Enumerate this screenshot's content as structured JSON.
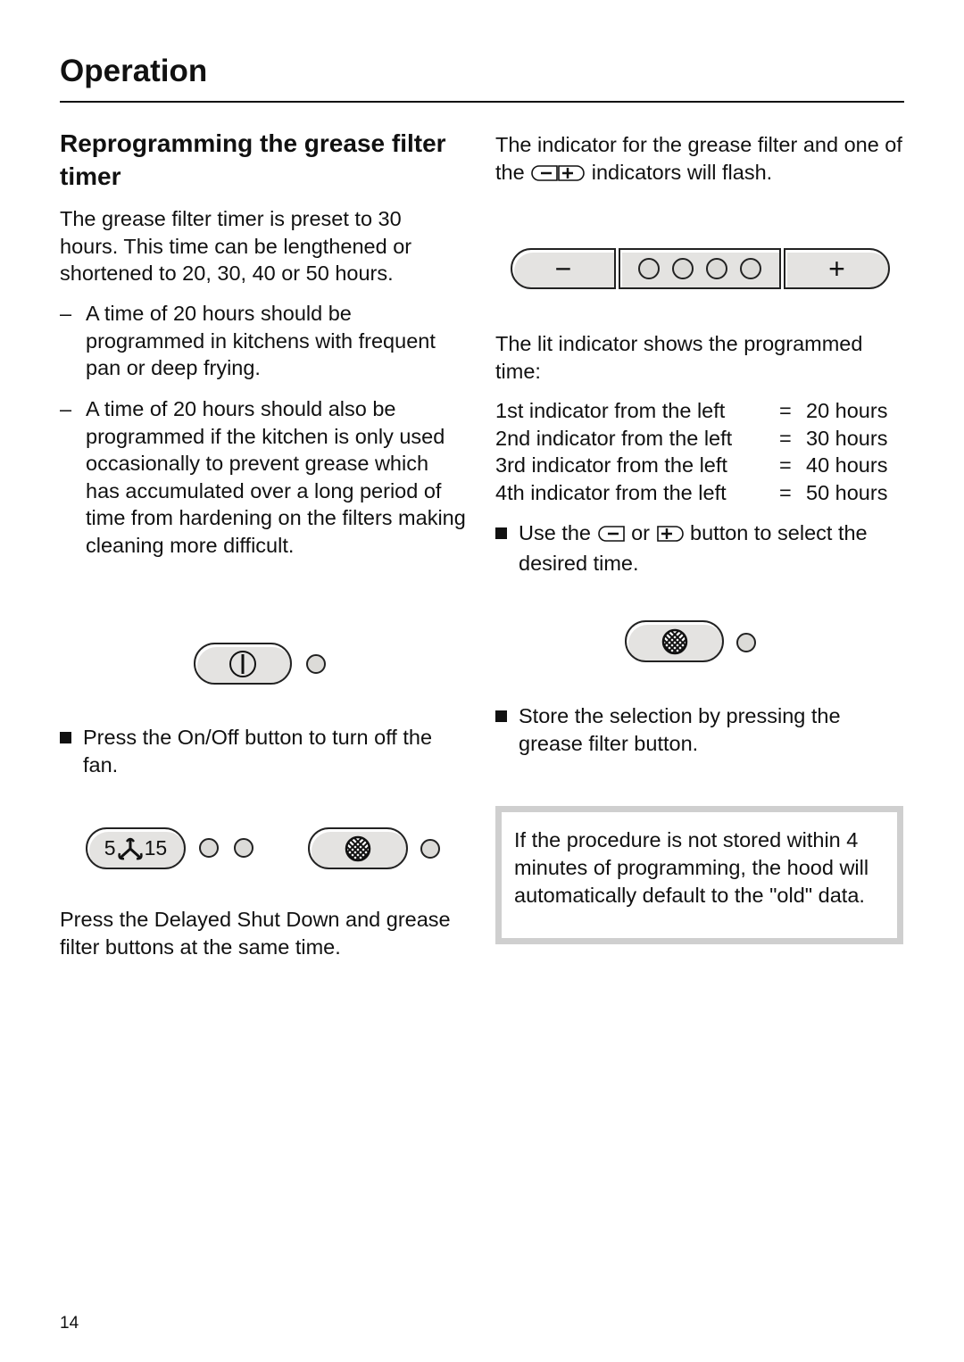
{
  "page": {
    "section_title": "Operation",
    "page_number": "14"
  },
  "left": {
    "heading": "Reprogramming the grease filter timer",
    "intro": "The grease filter timer is preset to 30 hours. This time can be lengthened or shortened to 20, 30, 40 or 50 hours.",
    "dash_items": [
      "A time of 20 hours should be programmed in kitchens with frequent pan or deep frying.",
      "A time of 20 hours should also be programmed if the kitchen is only used occasionally to prevent grease which has accumulated over a long period of time from hardening on the filters making cleaning more difficult."
    ],
    "dash_marker": "–",
    "step1": "Press the On/Off button to turn off the fan.",
    "step2": "Press the Delayed Shut Down and grease filter buttons at the same time.",
    "delay_button": {
      "left_num": "5",
      "right_num": "15",
      "icon": "fan-icon"
    }
  },
  "right": {
    "flash_text_a": "The indicator for the grease filter and one of the",
    "flash_text_b": "indicators will flash.",
    "minus_label": "−",
    "plus_label": "+",
    "indicator_count": 4,
    "lit_intro": "The lit indicator shows the programmed time:",
    "mapping": [
      {
        "label": "1st indicator from the left",
        "eq": "=",
        "value": "20 hours"
      },
      {
        "label": "2nd indicator from the left",
        "eq": "=",
        "value": "30 hours"
      },
      {
        "label": "3rd indicator from the left",
        "eq": "=",
        "value": "40 hours"
      },
      {
        "label": "4th indicator from the left",
        "eq": "=",
        "value": "50 hours"
      }
    ],
    "use_a": "Use the",
    "use_or": "or",
    "use_b": "button to select the desired time.",
    "store": "Store the selection by pressing the grease filter button.",
    "note": "If the procedure is not stored within 4 minutes of programming, the hood will automatically default to the \"old\" data."
  }
}
